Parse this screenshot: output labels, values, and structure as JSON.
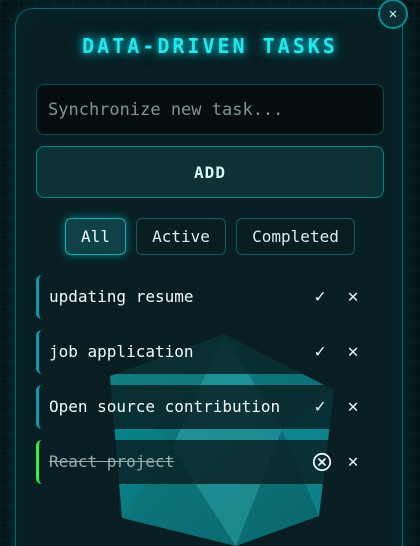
{
  "app": {
    "title": "DATA-DRIVEN TASKS"
  },
  "input": {
    "placeholder": "Synchronize new task...",
    "value": ""
  },
  "add_button": {
    "label": "ADD"
  },
  "filters": [
    {
      "label": "All",
      "active": true
    },
    {
      "label": "Active",
      "active": false
    },
    {
      "label": "Completed",
      "active": false
    }
  ],
  "tasks": [
    {
      "text": "updating resume",
      "completed": false
    },
    {
      "text": "job application",
      "completed": false
    },
    {
      "text": "Open source contribution",
      "completed": false
    },
    {
      "text": "React project",
      "completed": true
    }
  ],
  "icons": {
    "close": "close-icon",
    "complete": "check-icon",
    "undo": "undo-icon",
    "delete": "close-icon"
  },
  "colors": {
    "accent": "#22e8ee",
    "panel": "#09202a",
    "completed_marker": "#2ef04a"
  }
}
